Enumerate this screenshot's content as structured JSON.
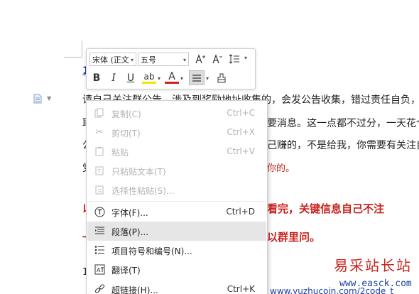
{
  "document": {
    "heading_fragment": "1",
    "lines": [
      "请自己关注群公告，涉及到奖励地址收集的，会发公告收集，错过责任自负，想",
      "耶",
      "要消息。这一点都不过分，一天花个",
      "公",
      "己赚的，不是给我，你需要有关注自",
      "党",
      "你的。"
    ],
    "red_line_1_left": "以",
    "red_line_1_right": "看完，关键信息自己不注",
    "red_line_2_left": "一",
    "red_line_2_right": "以群里问。",
    "bottom_number": "1",
    "bottom_link_fragment": "www.yuzhucoin.com/2code_t"
  },
  "toolbar": {
    "font_name": "宋体 (正文",
    "font_size": "五号",
    "grow_font": "A⁺",
    "shrink_font": "A⁻",
    "bold": "B",
    "italic": "I",
    "underline": "U",
    "highlight": "ab",
    "font_color": "A"
  },
  "context_menu": {
    "items": [
      {
        "label": "复制(C)",
        "shortcut": "Ctrl+C",
        "icon": "copy-icon",
        "enabled": false
      },
      {
        "label": "剪切(T)",
        "shortcut": "Ctrl+X",
        "icon": "scissors-icon",
        "enabled": false
      },
      {
        "label": "粘贴",
        "shortcut": "Ctrl+V",
        "icon": "paste-icon",
        "enabled": false
      },
      {
        "label": "只粘贴文本(T)",
        "shortcut": "",
        "icon": "paste-text-icon",
        "enabled": false
      },
      {
        "label": "选择性粘贴(S)...",
        "shortcut": "",
        "icon": "paste-special-icon",
        "enabled": false
      },
      {
        "label": "字体(F)...",
        "shortcut": "Ctrl+D",
        "icon": "font-icon",
        "enabled": true
      },
      {
        "label": "段落(P)...",
        "shortcut": "",
        "icon": "paragraph-icon",
        "enabled": true,
        "hovered": true
      },
      {
        "label": "项目符号和编号(N)...",
        "shortcut": "",
        "icon": "bullets-icon",
        "enabled": true
      },
      {
        "label": "翻译(T)",
        "shortcut": "",
        "icon": "translate-icon",
        "enabled": true
      },
      {
        "label": "超链接(H)...",
        "shortcut": "Ctrl+K",
        "icon": "hyperlink-icon",
        "enabled": true
      }
    ]
  },
  "watermark": {
    "text": "易采站长站",
    "url": "www.easck.com"
  },
  "colors": {
    "red_text": "#c8231e",
    "link_blue": "#1b3fa4",
    "menu_hover": "#e6e6e6",
    "disabled_text": "#b4b4b4"
  }
}
